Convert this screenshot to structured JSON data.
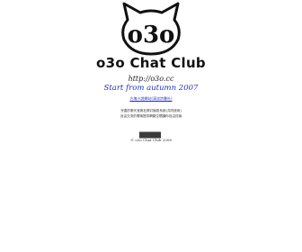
{
  "logo": {
    "text": "o3o",
    "site_name": "o3o Chat Club"
  },
  "url": "http://o3o.cc",
  "tagline": "Start from autumn 2007",
  "link_text": "方塊小說網站(清涼詩書社)",
  "description": {
    "line1": "完善的聊天室與社群討論區系統(共同使用)",
    "line2": "自由交流的環境提供網路空間讓你自由討論"
  },
  "copyright": "© o3o Chat Club 2008",
  "colors": {
    "accent": "#2233cc",
    "button": "#3b3b3b"
  }
}
